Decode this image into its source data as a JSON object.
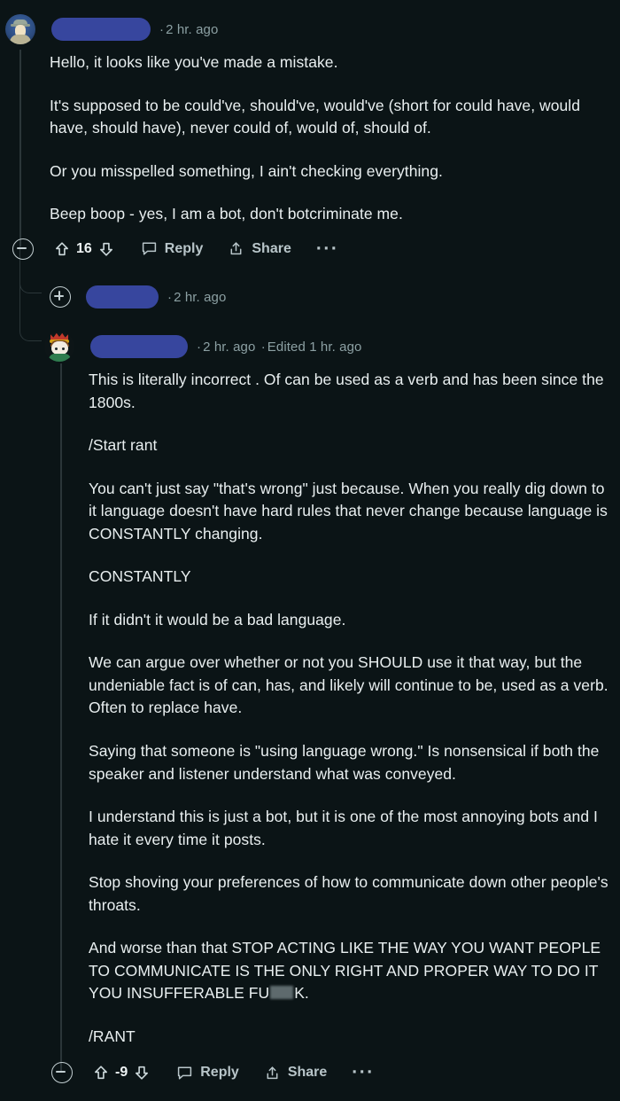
{
  "theme": {
    "background": "#0b1416",
    "text_primary": "#e9eff0",
    "text_muted": "#8ca0a3",
    "action_label": "#b8c5c9",
    "thread_line": "#2b3639",
    "redaction_blue": "#37469e",
    "censor_grey": "#5e6a6d"
  },
  "comments": [
    {
      "id": "bot-comment",
      "avatar": "default-user-avatar",
      "username_redacted": true,
      "timestamp": "2 hr. ago",
      "separator": "·",
      "paragraphs": [
        "Hello, it looks like you've made a mistake.",
        "It's supposed to be could've, should've, would've (short for could have, would have, should have), never could of, would of, should of.",
        "Or you misspelled something, I ain't checking everything.",
        "Beep boop - yes, I am a bot, don't botcriminate me."
      ],
      "actions": {
        "collapse": "collapse",
        "vote_count": "16",
        "upvote": "upvote",
        "downvote": "downvote",
        "reply_label": "Reply",
        "share_label": "Share",
        "more_label": "···"
      }
    },
    {
      "id": "collapsed-comment",
      "collapsed": true,
      "username_redacted": true,
      "timestamp": "2 hr. ago",
      "separator": "·",
      "expand": "expand"
    },
    {
      "id": "rant-comment",
      "avatar": "crown-snoo-avatar",
      "username_redacted": true,
      "timestamp": "2 hr. ago",
      "separator": "·",
      "edited_label": "Edited 1 hr. ago",
      "paragraphs": [
        "This is literally incorrect . Of can be used as a verb and has been since the 1800s.",
        "/Start rant",
        "You can't just say \"that's wrong\" just because. When you really dig down to it language doesn't have hard rules that never change because language is CONSTANTLY changing.",
        "CONSTANTLY",
        "If it didn't it would be a bad language.",
        "We can argue over whether or not you SHOULD use it that way, but the undeniable fact is of can, has, and likely will continue to be, used as a verb. Often to replace have.",
        "Saying that someone is \"using language wrong.\" Is nonsensical if both the speaker and listener understand what was conveyed.",
        "I understand this is just a bot, but it is one of the most annoying bots and I hate it every time it posts.",
        "Stop shoving your preferences of how to communicate down other people's throats.",
        "And worse than that STOP ACTING LIKE THE WAY YOU WANT PEOPLE TO COMMUNICATE IS THE ONLY RIGHT AND PROPER WAY TO DO IT YOU INSUFFERABLE FU",
        "/RANT"
      ],
      "censored_paragraph_prefix": "And worse than that STOP ACTING LIKE THE WAY YOU WANT PEOPLE TO COMMUNICATE IS THE ONLY RIGHT AND PROPER WAY TO DO IT YOU INSUFFERABLE FU",
      "censored_paragraph_suffix": "K.",
      "actions": {
        "collapse": "collapse",
        "vote_count": "-9",
        "upvote": "upvote",
        "downvote": "downvote",
        "reply_label": "Reply",
        "share_label": "Share",
        "more_label": "···"
      }
    }
  ]
}
